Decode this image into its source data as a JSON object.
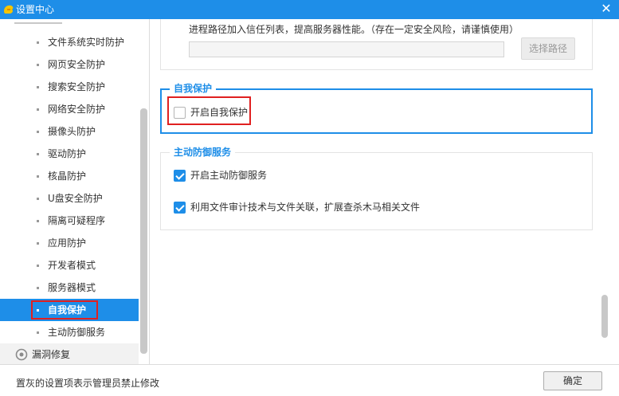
{
  "window": {
    "title": "设置中心",
    "close_glyph": "✕"
  },
  "sidebar": {
    "items": [
      {
        "label": "文件系统实时防护"
      },
      {
        "label": "网页安全防护"
      },
      {
        "label": "搜索安全防护"
      },
      {
        "label": "网络安全防护"
      },
      {
        "label": "摄像头防护"
      },
      {
        "label": "驱动防护"
      },
      {
        "label": "核晶防护"
      },
      {
        "label": "U盘安全防护"
      },
      {
        "label": "隔离可疑程序"
      },
      {
        "label": "应用防护"
      },
      {
        "label": "开发者模式"
      },
      {
        "label": "服务器模式"
      },
      {
        "label": "自我保护",
        "active": true
      },
      {
        "label": "主动防御服务"
      }
    ],
    "group": {
      "label": "漏洞修复",
      "icon": "repair-gear-icon"
    }
  },
  "content": {
    "trust_path": {
      "desc": "进程路径加入信任列表，提高服务器性能。（存在一定安全风险，请谨慎使用）",
      "input_value": "",
      "button_label": "选择路径"
    },
    "self_protect": {
      "legend": "自我保护",
      "options": [
        {
          "label": "开启自我保护",
          "checked": false
        }
      ]
    },
    "active_defense": {
      "legend": "主动防御服务",
      "options": [
        {
          "label": "开启主动防御服务",
          "checked": true
        },
        {
          "label": "利用文件审计技术与文件关联，扩展查杀木马相关文件",
          "checked": true
        }
      ]
    }
  },
  "footer": {
    "note": "置灰的设置项表示管理员禁止修改",
    "ok_label": "确定"
  },
  "colors": {
    "accent": "#1e8ee8",
    "highlight": "#e02020"
  }
}
